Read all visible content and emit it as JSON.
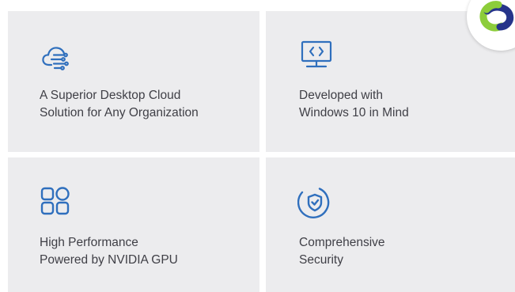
{
  "colors": {
    "card_background": "#ececee",
    "icon_blue": "#2f6fbd",
    "text": "#3f3f46",
    "logo_green": "#8ccd3a",
    "logo_navy": "#26348a"
  },
  "features": [
    {
      "icon": "cloud-network-icon",
      "text": "A Superior Desktop Cloud\nSolution for Any Organization"
    },
    {
      "icon": "monitor-code-icon",
      "text": "Developed  with\nWindows 10 in Mind"
    },
    {
      "icon": "apps-grid-icon",
      "text": "High Performance\nPowered by NVIDIA GPU"
    },
    {
      "icon": "shield-icon",
      "text": "Comprehensive\nSecurity"
    }
  ],
  "logo": {
    "icon": "cloud-logo-icon"
  }
}
